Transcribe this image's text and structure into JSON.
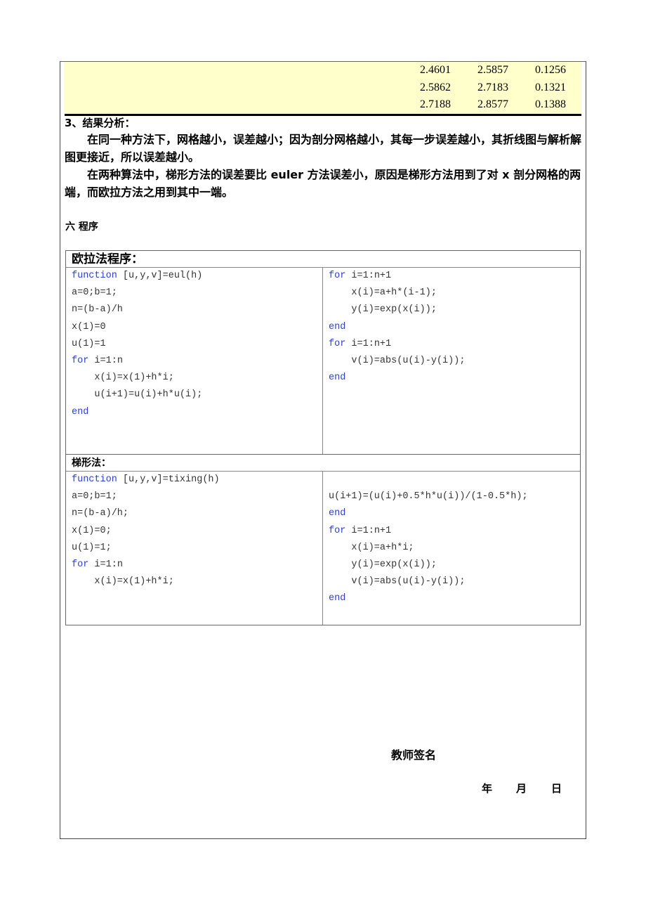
{
  "result_table": {
    "rows": [
      [
        "2.4601",
        "2.5857",
        "0.1256"
      ],
      [
        "2.5862",
        "2.7183",
        "0.1321"
      ],
      [
        "2.7188",
        "2.8577",
        "0.1388"
      ]
    ],
    "background": "#ffffcc"
  },
  "analysis": {
    "heading": "3、结果分析：",
    "paragraphs": [
      "在同一种方法下，网格越小，误差越小；因为剖分网格越小，其每一步误差越小，其折线图与解析解图更接近，所以误差越小。",
      "在两种算法中，梯形方法的误差要比 euler 方法误差小，原因是梯形方法用到了对 x 剖分网格的两端，而欧拉方法之用到其中一端。"
    ]
  },
  "section_title": "六  程序",
  "euler": {
    "title": "欧拉法程序：",
    "left": [
      {
        "kw": "function",
        "text": " [u,y,v]=eul(h)"
      },
      {
        "kw": "",
        "text": "a=0;b=1;"
      },
      {
        "kw": "",
        "text": "n=(b-a)/h"
      },
      {
        "kw": "",
        "text": "x(1)=0"
      },
      {
        "kw": "",
        "text": "u(1)=1"
      },
      {
        "kw": "for",
        "text": " i=1:n"
      },
      {
        "kw": "",
        "text": "    x(i)=x(1)+h*i;"
      },
      {
        "kw": "",
        "text": "    u(i+1)=u(i)+h*u(i);"
      },
      {
        "kw": "end",
        "text": ""
      }
    ],
    "right": [
      {
        "kw": "for",
        "text": " i=1:n+1"
      },
      {
        "kw": "",
        "text": "    x(i)=a+h*(i-1);"
      },
      {
        "kw": "",
        "text": "    y(i)=exp(x(i));"
      },
      {
        "kw": "end",
        "text": ""
      },
      {
        "kw": "for",
        "text": " i=1:n+1"
      },
      {
        "kw": "",
        "text": "    v(i)=abs(u(i)-y(i));"
      },
      {
        "kw": "end",
        "text": ""
      }
    ]
  },
  "trapezoid": {
    "title": "梯形法：",
    "left": [
      {
        "kw": "function",
        "text": " [u,y,v]=tixing(h)"
      },
      {
        "kw": "",
        "text": "a=0;b=1;"
      },
      {
        "kw": "",
        "text": "n=(b-a)/h;"
      },
      {
        "kw": "",
        "text": "x(1)=0;"
      },
      {
        "kw": "",
        "text": "u(1)=1;"
      },
      {
        "kw": "for",
        "text": " i=1:n"
      },
      {
        "kw": "",
        "text": "    x(i)=x(1)+h*i;"
      }
    ],
    "right": [
      {
        "kw": "",
        "text": ""
      },
      {
        "kw": "",
        "text": "u(i+1)=(u(i)+0.5*h*u(i))/(1-0.5*h);"
      },
      {
        "kw": "end",
        "text": ""
      },
      {
        "kw": "for",
        "text": " i=1:n+1"
      },
      {
        "kw": "",
        "text": "    x(i)=a+h*i;"
      },
      {
        "kw": "",
        "text": "    y(i)=exp(x(i));"
      },
      {
        "kw": "",
        "text": "    v(i)=abs(u(i)-y(i));"
      },
      {
        "kw": "end",
        "text": ""
      }
    ]
  },
  "signature": {
    "label": "教师签名",
    "year": "年",
    "month": "月",
    "day": "日"
  },
  "colors": {
    "keyword": "#2a3fd6",
    "code_text": "#333333"
  }
}
